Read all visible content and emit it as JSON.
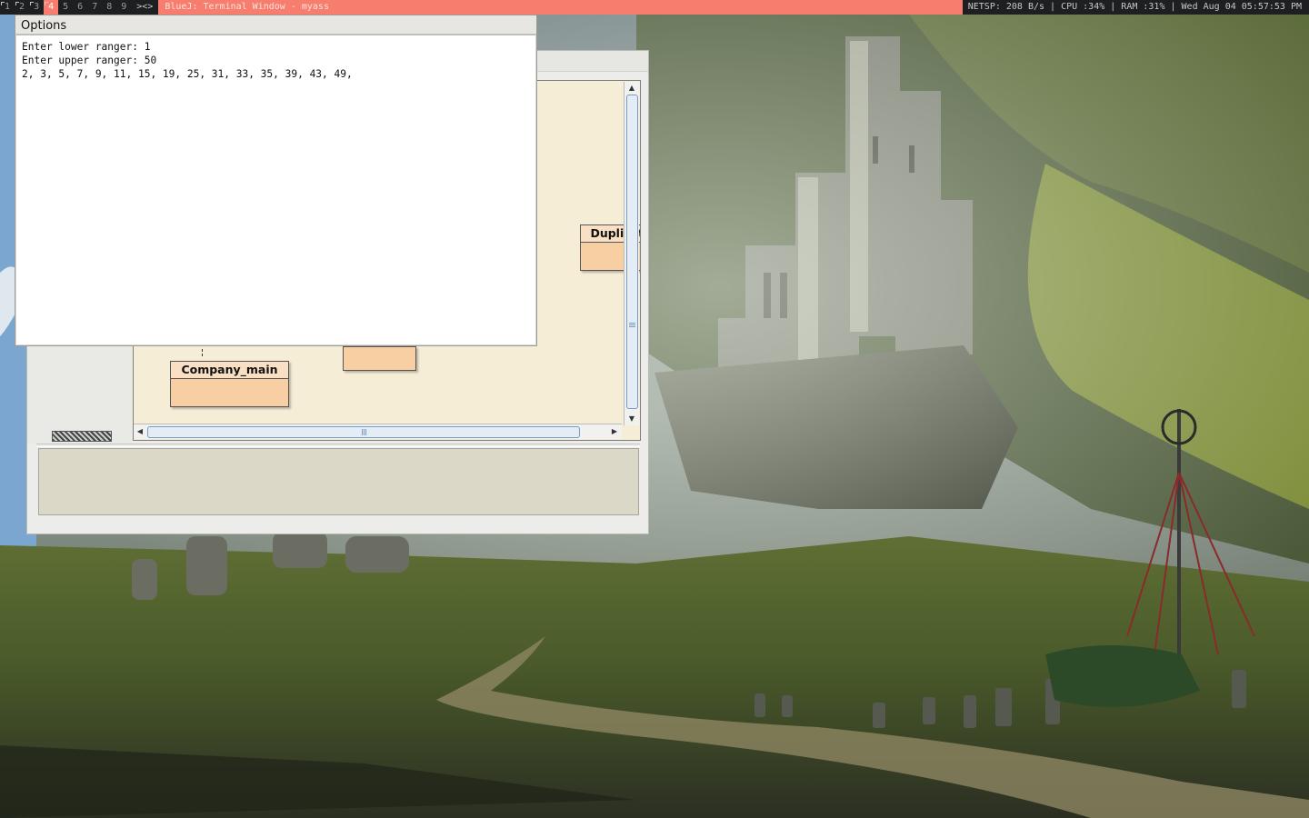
{
  "topbar": {
    "workspaces": [
      {
        "label": "1",
        "occupied": true
      },
      {
        "label": "2",
        "occupied": true
      },
      {
        "label": "3",
        "occupied": true
      },
      {
        "label": "4",
        "occupied": true,
        "active": true
      },
      {
        "label": "5"
      },
      {
        "label": "6"
      },
      {
        "label": "7"
      },
      {
        "label": "8"
      },
      {
        "label": "9"
      }
    ],
    "layout_symbol": "><>",
    "window_title": "BlueJ: Terminal Window - myass",
    "status": "NETSP: 208 B/s | CPU :34% | RAM :31% | Wed Aug 04 05:57:53 PM",
    "accent_color": "#f77e6e",
    "bar_color": "#1d1f21"
  },
  "terminal": {
    "menu": {
      "options_label": "Options"
    },
    "lines": [
      "Enter lower ranger: 1",
      "Enter upper ranger: 50",
      "2, 3, 5, 7, 9, 11, 15, 19, 25, 31, 33, 35, 39, 43, 49,"
    ]
  },
  "bluej": {
    "classes": {
      "company_main": "Company_main",
      "duplicate": "Duplicate",
      "unnamed": ""
    },
    "class_color": "#f7cfa3",
    "diagram_background": "#f5edd6"
  }
}
